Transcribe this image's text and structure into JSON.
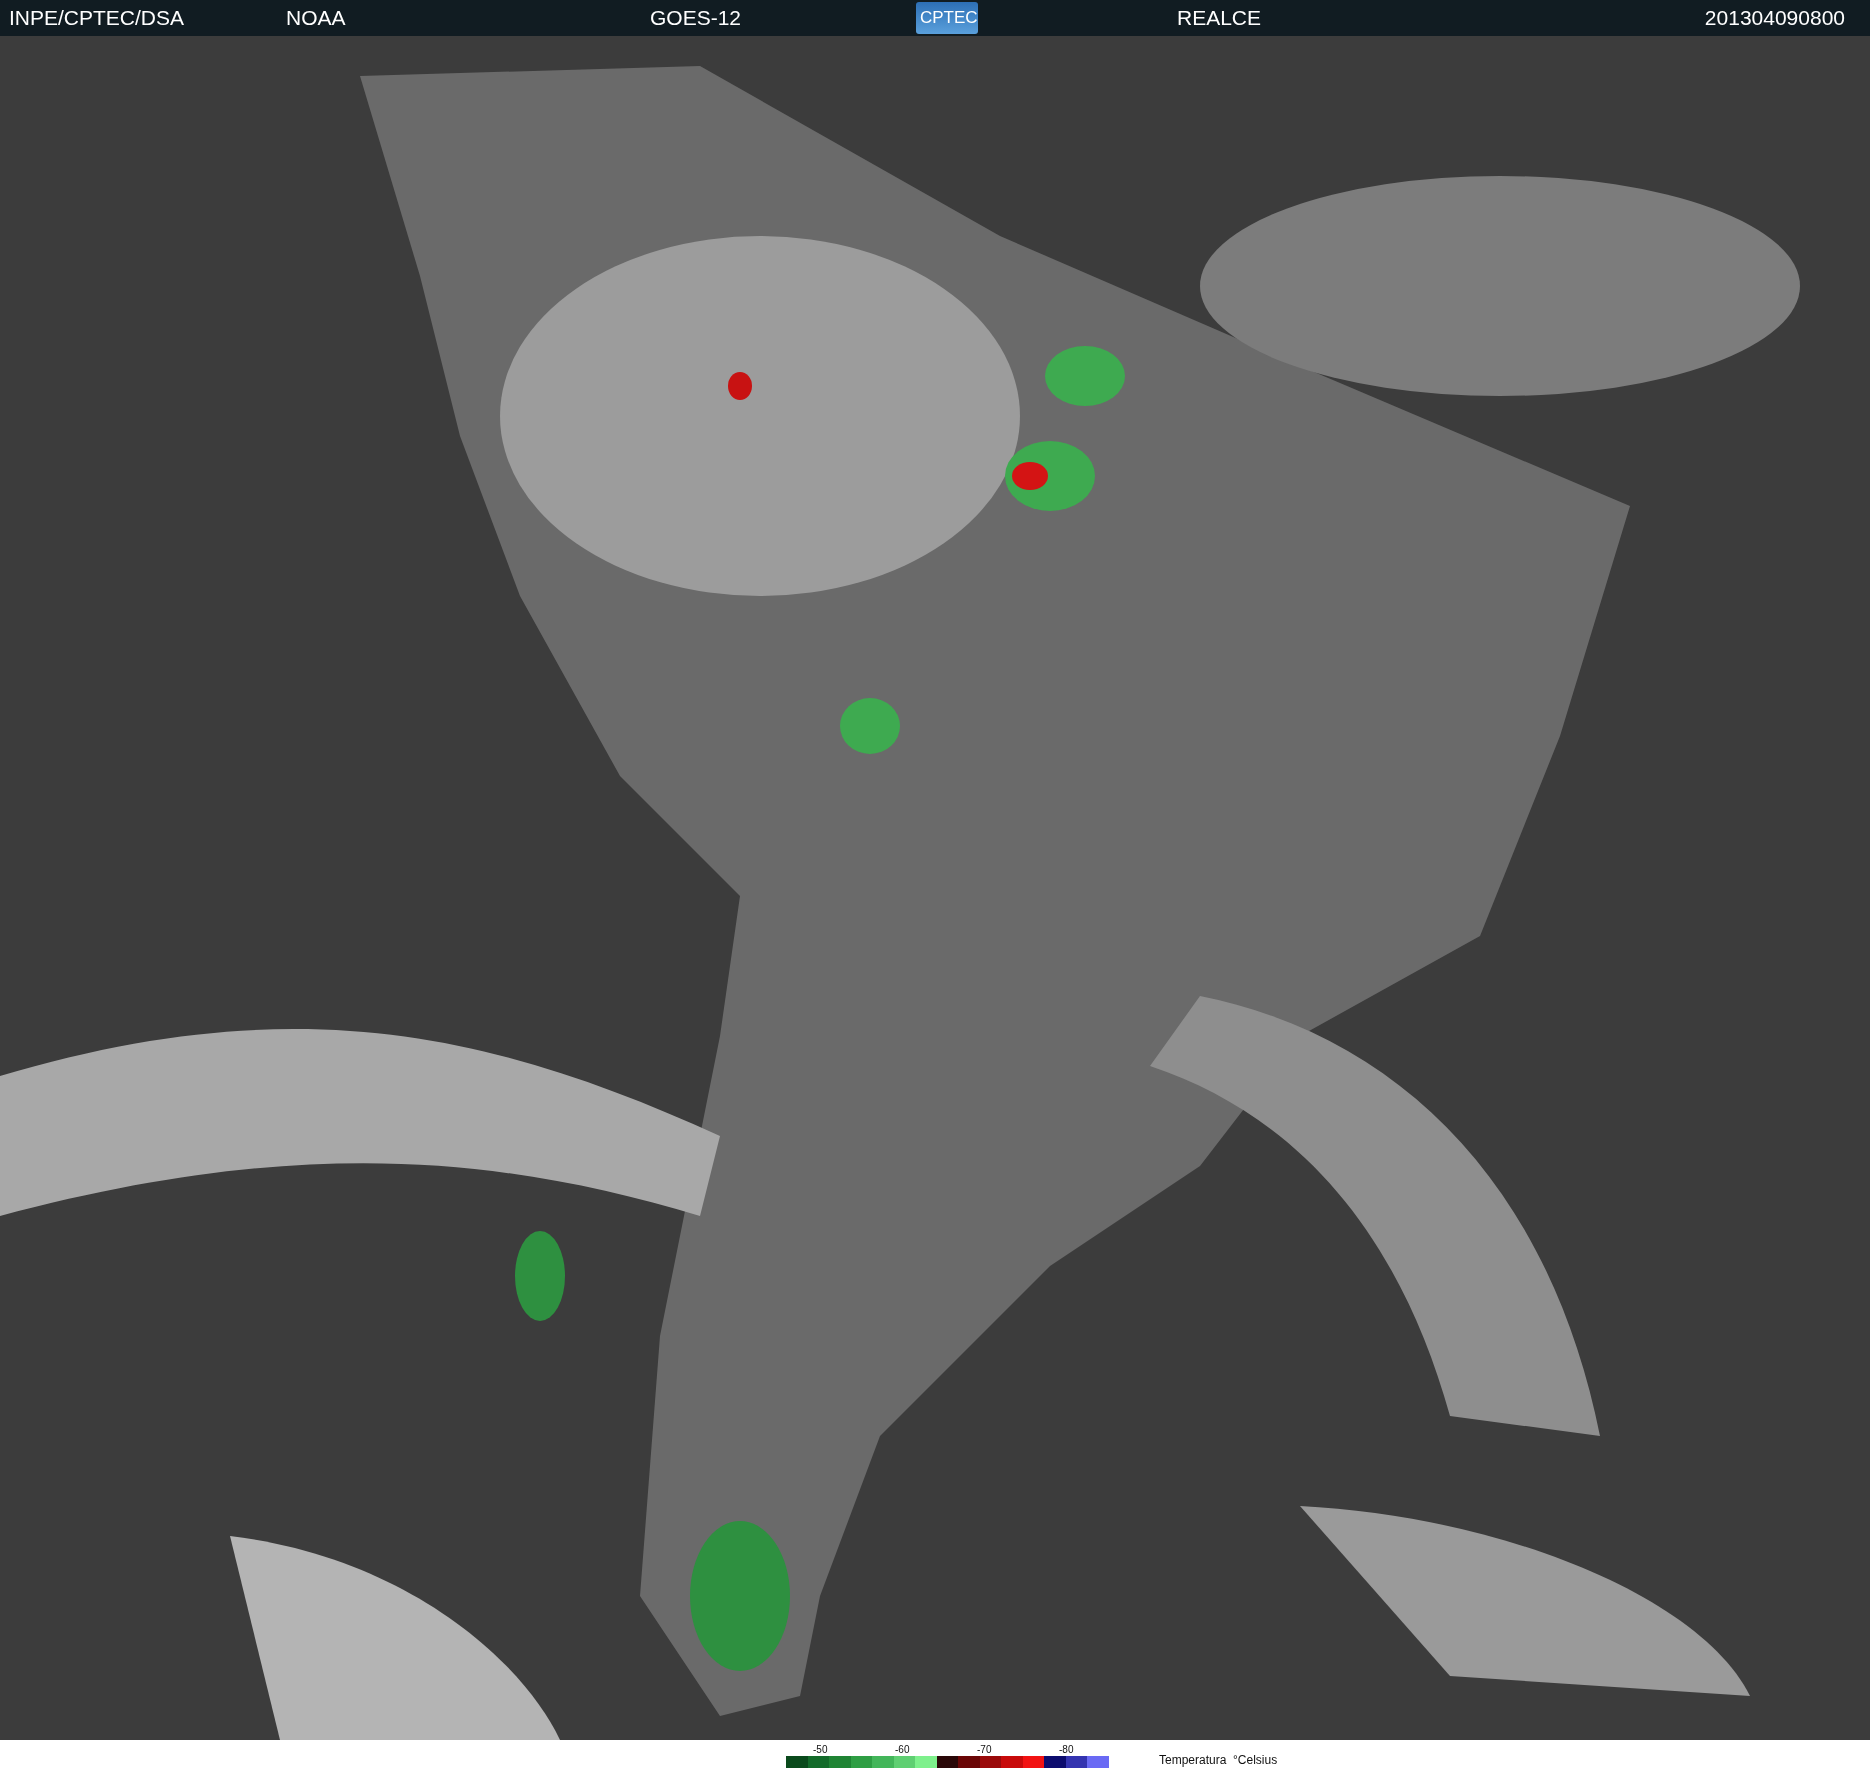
{
  "header": {
    "items": [
      "INPE/CPTEC/DSA",
      "NOAA",
      "GOES-12"
    ],
    "logo": "CPTEC",
    "mode": "REALCE",
    "timestamp": "201304090800"
  },
  "legend": {
    "ticks": [
      "-50",
      "-60",
      "-70",
      "-80"
    ],
    "title": "Temperatura  °Celsius",
    "swatches": [
      {
        "color": "#0a4a1c"
      },
      {
        "color": "#136b2a"
      },
      {
        "color": "#1f8434"
      },
      {
        "color": "#2e9e44"
      },
      {
        "color": "#43b65a"
      },
      {
        "color": "#5fcf72"
      },
      {
        "color": "#7ef08c"
      },
      {
        "color": "#2a0808"
      },
      {
        "color": "#6a0606"
      },
      {
        "color": "#9a0a0a"
      },
      {
        "color": "#c80a0a"
      },
      {
        "color": "#f21212"
      },
      {
        "color": "#0c0c6e"
      },
      {
        "color": "#3434b0"
      },
      {
        "color": "#6a6af4"
      }
    ]
  }
}
